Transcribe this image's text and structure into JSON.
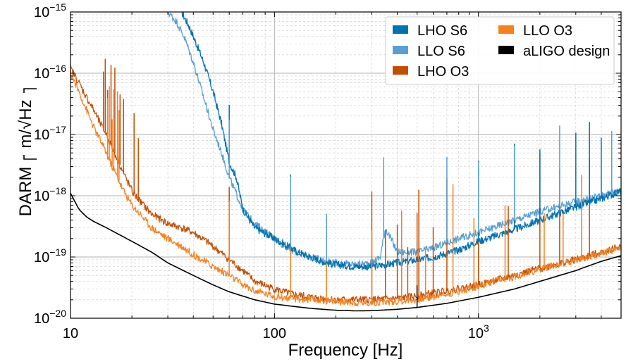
{
  "chart_data": {
    "type": "line",
    "title": "",
    "xlabel": "Frequency [Hz]",
    "ylabel_main": "DARM",
    "ylabel_unit": "m/√Hz",
    "xscale": "log",
    "yscale": "log",
    "xlim": [
      10,
      5000
    ],
    "ylim": [
      1e-20,
      1e-15
    ],
    "grid": true,
    "legend_position": "top-right",
    "legend_columns": 2,
    "x_tick_labels": [
      {
        "value": 10,
        "text": "10"
      },
      {
        "value": 100,
        "text": "100"
      },
      {
        "value": 1000,
        "base": "10",
        "exp": "3"
      }
    ],
    "y_tick_labels": [
      {
        "value": 1e-15,
        "base": "10",
        "exp": "−15"
      },
      {
        "value": 1e-16,
        "base": "10",
        "exp": "−16"
      },
      {
        "value": 1e-17,
        "base": "10",
        "exp": "−17"
      },
      {
        "value": 1e-18,
        "base": "10",
        "exp": "−18"
      },
      {
        "value": 1e-19,
        "base": "10",
        "exp": "−19"
      },
      {
        "value": 1e-20,
        "base": "10",
        "exp": "−20"
      }
    ],
    "series": [
      {
        "name": "LHO S6",
        "color": "#0072b2",
        "x": [
          35,
          38,
          40,
          45,
          50,
          55,
          60,
          65,
          70,
          80,
          100,
          130,
          150,
          180,
          200,
          250,
          300,
          350,
          400,
          500,
          600,
          800,
          1000,
          1500,
          2000,
          3000,
          4000,
          5000
        ],
        "y": [
          1e-15,
          6e-16,
          4e-16,
          1.5e-16,
          5e-17,
          1.5e-17,
          3.5e-18,
          2e-18,
          6e-19,
          3e-19,
          2e-19,
          1.2e-19,
          1e-19,
          8e-20,
          7.5e-20,
          7e-20,
          7e-20,
          7.5e-20,
          8e-20,
          9e-20,
          1e-19,
          1.3e-19,
          1.8e-19,
          2.8e-19,
          4e-19,
          6.5e-19,
          9e-19,
          1.2e-18
        ]
      },
      {
        "name": "LLO S6",
        "color": "#5a9fd4",
        "x": [
          30,
          33,
          36,
          40,
          45,
          50,
          55,
          60,
          70,
          80,
          100,
          120,
          150,
          180,
          200,
          250,
          300,
          330,
          350,
          400,
          500,
          600,
          800,
          1000,
          1500,
          2000,
          3000,
          4000,
          5000
        ],
        "y": [
          1e-15,
          7e-16,
          4e-16,
          1.5e-16,
          4e-17,
          1.2e-17,
          5e-18,
          2e-18,
          6e-19,
          3.5e-19,
          2e-19,
          1.3e-19,
          1e-19,
          8.5e-20,
          8e-20,
          7.5e-20,
          8e-20,
          1e-19,
          3e-19,
          1.2e-19,
          1.2e-19,
          1.4e-19,
          2e-19,
          2.5e-19,
          4e-19,
          5.5e-19,
          8e-19,
          1e-18,
          1.3e-18
        ]
      },
      {
        "name": "LHO O3",
        "color": "#c44e00",
        "x": [
          10,
          11,
          12,
          13,
          14,
          15,
          16,
          17,
          18,
          20,
          22,
          25,
          30,
          35,
          40,
          50,
          60,
          70,
          80,
          100,
          120,
          150,
          200,
          250,
          300,
          400,
          500,
          700,
          1000,
          1500,
          2000,
          3000,
          4000,
          5000
        ],
        "y": [
          1.2e-16,
          7e-17,
          4e-17,
          2.5e-17,
          1.5e-17,
          1e-17,
          6e-18,
          4e-18,
          2.5e-18,
          1.2e-18,
          8e-19,
          5e-19,
          3.5e-19,
          3e-19,
          2.5e-19,
          1.5e-19,
          9e-20,
          6e-20,
          4e-20,
          3e-20,
          2.5e-20,
          2.2e-20,
          2e-20,
          2e-20,
          2e-20,
          2.1e-20,
          2.3e-20,
          2.8e-20,
          3.5e-20,
          5e-20,
          6.5e-20,
          9e-20,
          1.2e-19,
          1.5e-19
        ]
      },
      {
        "name": "LLO O3",
        "color": "#f5811f",
        "x": [
          10,
          11,
          12,
          13,
          14,
          15,
          16,
          17,
          18,
          20,
          22,
          25,
          30,
          35,
          40,
          50,
          60,
          70,
          80,
          100,
          120,
          150,
          200,
          250,
          300,
          400,
          500,
          700,
          1000,
          1500,
          2000,
          3000,
          4000,
          5000
        ],
        "y": [
          1e-16,
          5e-17,
          2.5e-17,
          1.3e-17,
          8e-18,
          5e-18,
          3e-18,
          2e-18,
          1.3e-18,
          7e-19,
          5e-19,
          3e-19,
          2e-19,
          1.5e-19,
          1.1e-19,
          7e-20,
          5e-20,
          3.5e-20,
          2.8e-20,
          2.3e-20,
          2.1e-20,
          2e-20,
          1.9e-20,
          1.8e-20,
          1.8e-20,
          1.9e-20,
          2e-20,
          2.5e-20,
          3.3e-20,
          4.8e-20,
          6.3e-20,
          9e-20,
          1.15e-19,
          1.4e-19
        ]
      },
      {
        "name": "aLIGO design",
        "color": "#000000",
        "x": [
          10,
          11,
          12,
          13,
          15,
          17,
          20,
          25,
          30,
          40,
          50,
          60,
          80,
          100,
          150,
          200,
          250,
          300,
          400,
          500,
          700,
          1000,
          1500,
          2000,
          3000,
          4000,
          5000
        ],
        "y": [
          1.1e-18,
          6e-19,
          4.5e-19,
          3.8e-19,
          3e-19,
          2.4e-19,
          1.8e-19,
          1.2e-19,
          8e-20,
          5e-20,
          3.5e-20,
          2.7e-20,
          2e-20,
          1.7e-20,
          1.45e-20,
          1.35e-20,
          1.32e-20,
          1.33e-20,
          1.4e-20,
          1.5e-20,
          1.75e-20,
          2.2e-20,
          3e-20,
          4e-20,
          6e-20,
          8.5e-20,
          1.05e-19
        ]
      }
    ],
    "spikes": [
      {
        "series": "LHO O3",
        "x": [
          14.5,
          14.8,
          15.2,
          15.8,
          16.5,
          17.5,
          18.2,
          20.5,
          21.5,
          60,
          120,
          180,
          300,
          350,
          400,
          420,
          450,
          500,
          510,
          600,
          700,
          1000,
          1400,
          2000,
          2500,
          3500
        ]
      },
      {
        "series": "LLO O3",
        "x": [
          15.2,
          15.5,
          16,
          16.3,
          17,
          17.3,
          60,
          120,
          180,
          300,
          420,
          550,
          750,
          950,
          1350,
          2100,
          2600,
          3200
        ]
      },
      {
        "series": "LHO S6",
        "x": [
          60,
          120,
          180,
          1000,
          1500,
          2000,
          3000,
          3500,
          4000
        ]
      },
      {
        "series": "LLO S6",
        "x": [
          60,
          120,
          180,
          343,
          700,
          1000,
          1500,
          2500,
          4500
        ]
      },
      {
        "series": "aLIGO design",
        "x": [
          500
        ]
      }
    ]
  }
}
